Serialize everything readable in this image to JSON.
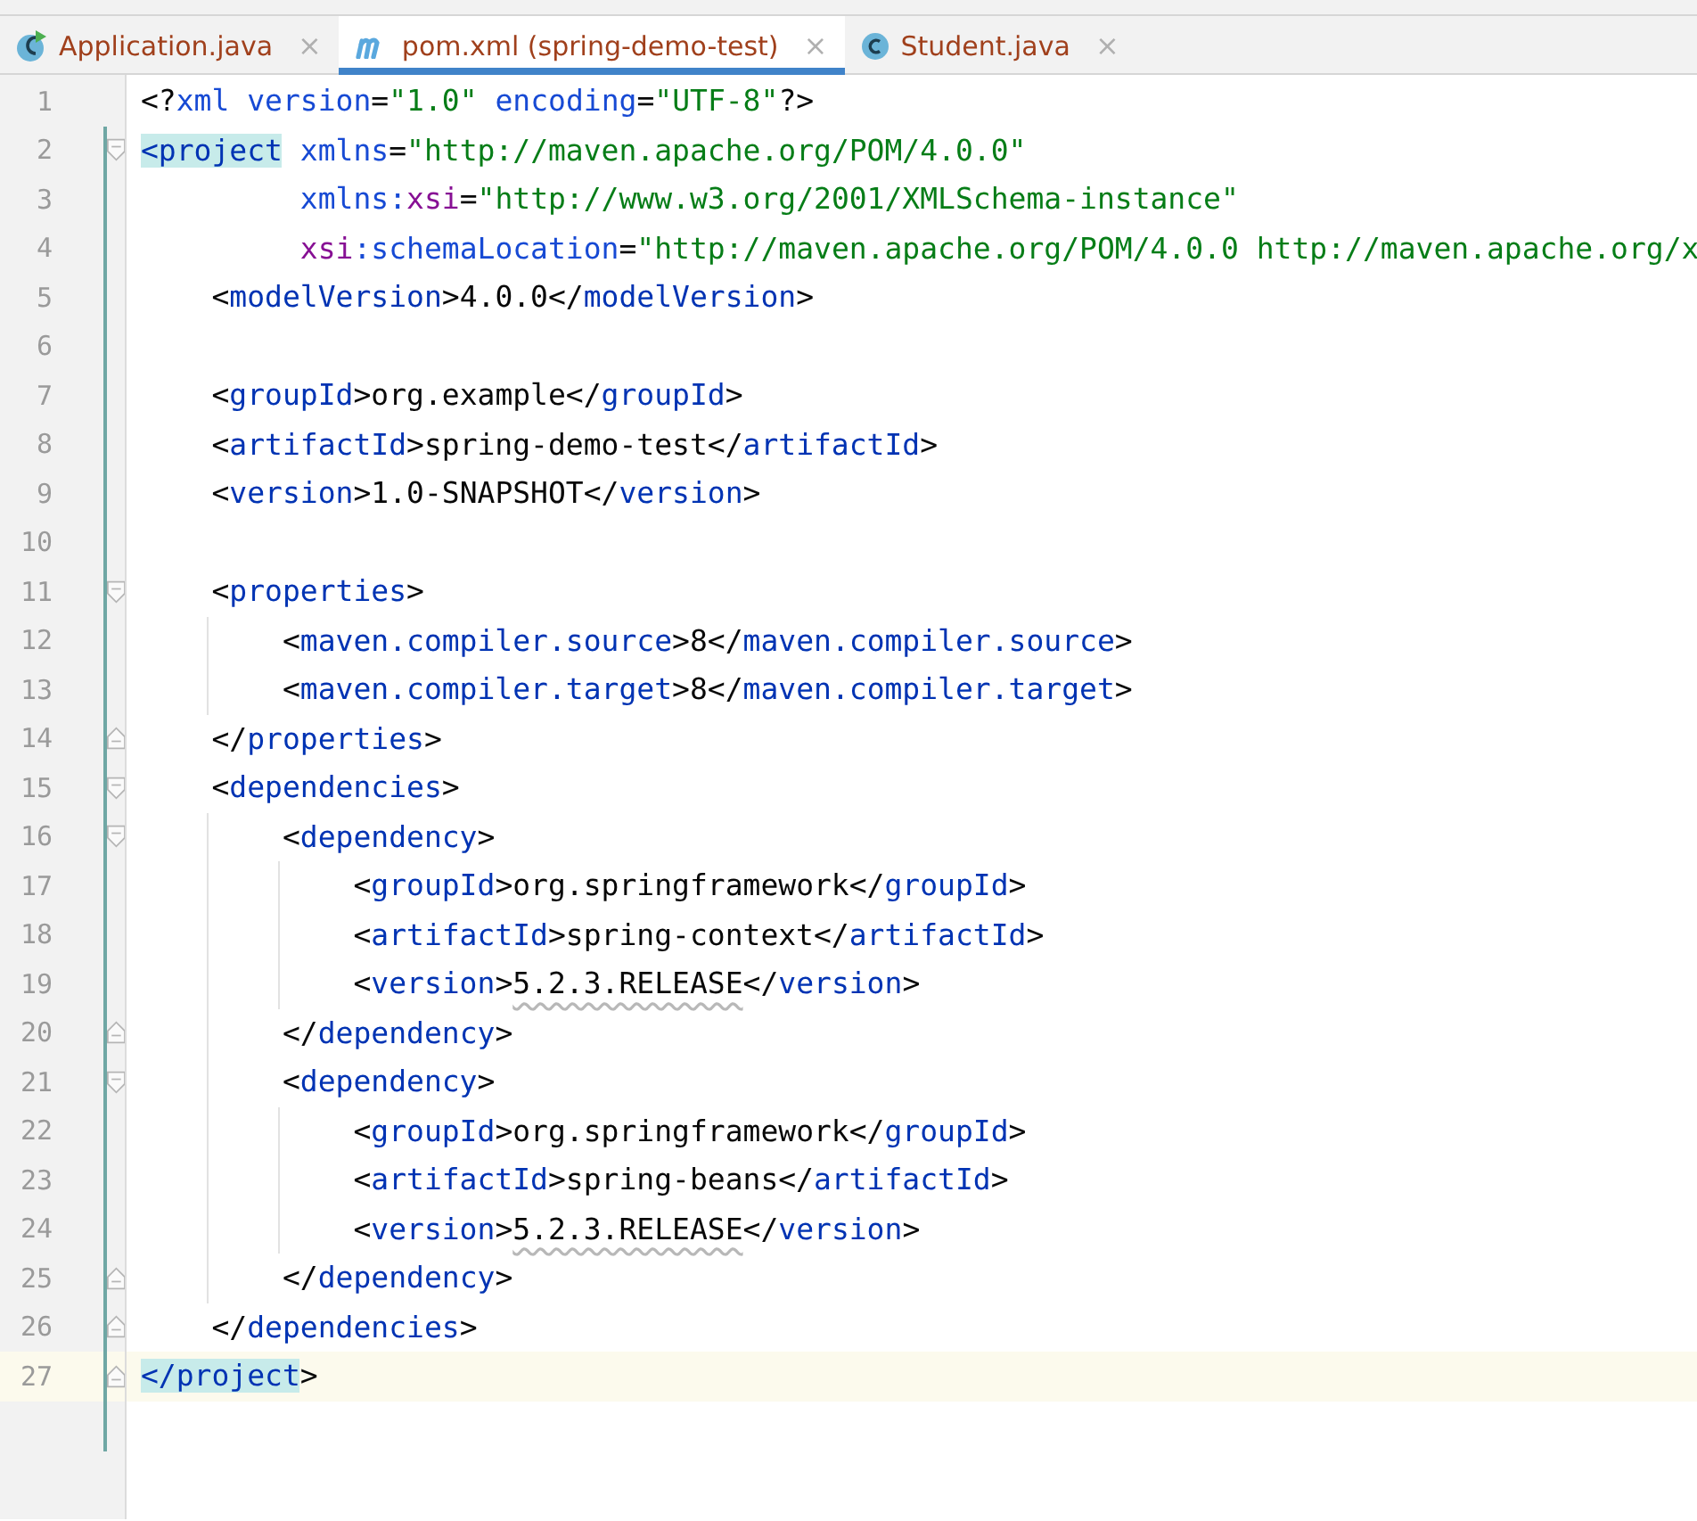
{
  "tabs": [
    {
      "label": "Application.java",
      "kind": "class_run",
      "selected": false,
      "close": "×"
    },
    {
      "label": "pom.xml (spring-demo-test)",
      "kind": "maven",
      "selected": true,
      "close": "×"
    },
    {
      "label": "Student.java",
      "kind": "class",
      "selected": false,
      "close": "×"
    }
  ],
  "editor": {
    "lines": [
      {
        "number": "1",
        "kind": "plain",
        "current": false,
        "tag_match": false,
        "tokens": [
          {
            "text": "<?",
            "kind": "bracket"
          },
          {
            "text": "xml ",
            "kind": "attr"
          },
          {
            "text": "version",
            "kind": "attr"
          },
          {
            "text": "=",
            "kind": "bracket"
          },
          {
            "text": "\"1.0\" ",
            "kind": "value"
          },
          {
            "text": "encoding",
            "kind": "attr"
          },
          {
            "text": "=",
            "kind": "bracket"
          },
          {
            "text": "\"UTF-8\"",
            "kind": "value"
          },
          {
            "text": "?>",
            "kind": "bracket"
          }
        ]
      },
      {
        "number": "2",
        "kind": "fold_start",
        "current": false,
        "tag_match": true,
        "tokens": [
          {
            "text": "<project",
            "kind": "tag"
          },
          {
            "text": " xmlns",
            "kind": "attr"
          },
          {
            "text": "=",
            "kind": "bracket"
          },
          {
            "text": "\"http://maven.apache.org/POM/4.0.0\"",
            "kind": "value"
          }
        ]
      },
      {
        "number": "3",
        "kind": "plain",
        "current": false,
        "tag_match": false,
        "tokens": [
          {
            "text": "         xmlns:",
            "kind": "attr"
          },
          {
            "text": "xsi",
            "kind": "ns"
          },
          {
            "text": "=",
            "kind": "bracket"
          },
          {
            "text": "\"http://www.w3.org/2001/XMLSchema-instance\"",
            "kind": "value"
          }
        ]
      },
      {
        "number": "4",
        "kind": "plain",
        "current": false,
        "tag_match": false,
        "tokens": [
          {
            "text": "         xsi",
            "kind": "ns"
          },
          {
            "text": ":schemaLocation",
            "kind": "attr"
          },
          {
            "text": "=",
            "kind": "bracket"
          },
          {
            "text": "\"http://maven.apache.org/POM/4.0.0 http://maven.apache.org/x",
            "kind": "value"
          }
        ]
      },
      {
        "number": "5",
        "kind": "plain",
        "current": false,
        "tag_match": false,
        "tokens": [
          {
            "text": "    <",
            "kind": "bracket"
          },
          {
            "text": "modelVersion",
            "kind": "tag"
          },
          {
            "text": ">4.0.0</",
            "kind": "bracket"
          },
          {
            "text": "modelVersion",
            "kind": "tag"
          },
          {
            "text": ">",
            "kind": "bracket"
          }
        ]
      },
      {
        "number": "6",
        "kind": "plain",
        "current": false,
        "tag_match": false
      },
      {
        "number": "7",
        "kind": "plain",
        "current": false,
        "tag_match": false,
        "tokens": [
          {
            "text": "    <",
            "kind": "bracket"
          },
          {
            "text": "groupId",
            "kind": "tag"
          },
          {
            "text": ">org.example</",
            "kind": "bracket"
          },
          {
            "text": "groupId",
            "kind": "tag"
          },
          {
            "text": ">",
            "kind": "bracket"
          }
        ]
      },
      {
        "number": "8",
        "kind": "plain",
        "current": false,
        "tag_match": false,
        "tokens": [
          {
            "text": "    <",
            "kind": "bracket"
          },
          {
            "text": "artifactId",
            "kind": "tag"
          },
          {
            "text": ">spring-demo-test</",
            "kind": "bracket"
          },
          {
            "text": "artifactId",
            "kind": "tag"
          },
          {
            "text": ">",
            "kind": "bracket"
          }
        ]
      },
      {
        "number": "9",
        "kind": "plain",
        "current": false,
        "tag_match": false,
        "tokens": [
          {
            "text": "    <",
            "kind": "bracket"
          },
          {
            "text": "version",
            "kind": "tag"
          },
          {
            "text": ">1.0-SNAPSHOT</",
            "kind": "bracket"
          },
          {
            "text": "version",
            "kind": "tag"
          },
          {
            "text": ">",
            "kind": "bracket"
          }
        ]
      },
      {
        "number": "10",
        "kind": "plain",
        "current": false,
        "tag_match": false
      },
      {
        "number": "11",
        "kind": "fold_start",
        "current": false,
        "tag_match": false,
        "tokens": [
          {
            "text": "    <",
            "kind": "bracket"
          },
          {
            "text": "properties",
            "kind": "tag"
          },
          {
            "text": ">",
            "kind": "bracket"
          }
        ]
      },
      {
        "number": "12",
        "kind": "plain",
        "current": false,
        "tag_match": false,
        "tokens": [
          {
            "text": "        <",
            "kind": "bracket"
          },
          {
            "text": "maven.compiler.source",
            "kind": "tag"
          },
          {
            "text": ">8</",
            "kind": "bracket"
          },
          {
            "text": "maven.compiler.source",
            "kind": "tag"
          },
          {
            "text": ">",
            "kind": "bracket"
          }
        ]
      },
      {
        "number": "13",
        "kind": "plain",
        "current": false,
        "tag_match": false,
        "tokens": [
          {
            "text": "        <",
            "kind": "bracket"
          },
          {
            "text": "maven.compiler.target",
            "kind": "tag"
          },
          {
            "text": ">8</",
            "kind": "bracket"
          },
          {
            "text": "maven.compiler.target",
            "kind": "tag"
          },
          {
            "text": ">",
            "kind": "bracket"
          }
        ]
      },
      {
        "number": "14",
        "kind": "fold_end",
        "current": false,
        "tag_match": false,
        "tokens": [
          {
            "text": "    </",
            "kind": "bracket"
          },
          {
            "text": "properties",
            "kind": "tag"
          },
          {
            "text": ">",
            "kind": "bracket"
          }
        ]
      },
      {
        "number": "15",
        "kind": "fold_start",
        "current": false,
        "tag_match": false,
        "tokens": [
          {
            "text": "    <",
            "kind": "bracket"
          },
          {
            "text": "dependencies",
            "kind": "tag"
          },
          {
            "text": ">",
            "kind": "bracket"
          }
        ]
      },
      {
        "number": "16",
        "kind": "fold_start",
        "current": false,
        "tag_match": false,
        "tokens": [
          {
            "text": "        <",
            "kind": "bracket"
          },
          {
            "text": "dependency",
            "kind": "tag"
          },
          {
            "text": ">",
            "kind": "bracket"
          }
        ]
      },
      {
        "number": "17",
        "kind": "plain",
        "current": false,
        "tag_match": false,
        "tokens": [
          {
            "text": "            <",
            "kind": "bracket"
          },
          {
            "text": "groupId",
            "kind": "tag"
          },
          {
            "text": ">org.springframework</",
            "kind": "bracket"
          },
          {
            "text": "groupId",
            "kind": "tag"
          },
          {
            "text": ">",
            "kind": "bracket"
          }
        ]
      },
      {
        "number": "18",
        "kind": "plain",
        "current": false,
        "tag_match": false,
        "tokens": [
          {
            "text": "            <",
            "kind": "bracket"
          },
          {
            "text": "artifactId",
            "kind": "tag"
          },
          {
            "text": ">spring-context</",
            "kind": "bracket"
          },
          {
            "text": "artifactId",
            "kind": "tag"
          },
          {
            "text": ">",
            "kind": "bracket"
          }
        ]
      },
      {
        "number": "19",
        "kind": "plain",
        "current": false,
        "tag_match": false,
        "tokens": [
          {
            "text": "            <",
            "kind": "bracket"
          },
          {
            "text": "version",
            "kind": "tag"
          },
          {
            "text": ">",
            "kind": "bracket"
          },
          {
            "text": "5.2.3.RELEASE",
            "kind": "warning"
          },
          {
            "text": "</",
            "kind": "bracket"
          },
          {
            "text": "version",
            "kind": "tag"
          },
          {
            "text": ">",
            "kind": "bracket"
          }
        ]
      },
      {
        "number": "20",
        "kind": "fold_end",
        "current": false,
        "tag_match": false,
        "tokens": [
          {
            "text": "        </",
            "kind": "bracket"
          },
          {
            "text": "dependency",
            "kind": "tag"
          },
          {
            "text": ">",
            "kind": "bracket"
          }
        ]
      },
      {
        "number": "21",
        "kind": "fold_start",
        "current": false,
        "tag_match": false,
        "tokens": [
          {
            "text": "        <",
            "kind": "bracket"
          },
          {
            "text": "dependency",
            "kind": "tag"
          },
          {
            "text": ">",
            "kind": "bracket"
          }
        ]
      },
      {
        "number": "22",
        "kind": "plain",
        "current": false,
        "tag_match": false,
        "tokens": [
          {
            "text": "            <",
            "kind": "bracket"
          },
          {
            "text": "groupId",
            "kind": "tag"
          },
          {
            "text": ">org.springframework</",
            "kind": "bracket"
          },
          {
            "text": "groupId",
            "kind": "tag"
          },
          {
            "text": ">",
            "kind": "bracket"
          }
        ]
      },
      {
        "number": "23",
        "kind": "plain",
        "current": false,
        "tag_match": false,
        "tokens": [
          {
            "text": "            <",
            "kind": "bracket"
          },
          {
            "text": "artifactId",
            "kind": "tag"
          },
          {
            "text": ">spring-beans</",
            "kind": "bracket"
          },
          {
            "text": "artifactId",
            "kind": "tag"
          },
          {
            "text": ">",
            "kind": "bracket"
          }
        ]
      },
      {
        "number": "24",
        "kind": "plain",
        "current": false,
        "tag_match": false,
        "tokens": [
          {
            "text": "            <",
            "kind": "bracket"
          },
          {
            "text": "version",
            "kind": "tag"
          },
          {
            "text": ">",
            "kind": "bracket"
          },
          {
            "text": "5.2.3.RELEASE",
            "kind": "warning"
          },
          {
            "text": "</",
            "kind": "bracket"
          },
          {
            "text": "version",
            "kind": "tag"
          },
          {
            "text": ">",
            "kind": "bracket"
          }
        ]
      },
      {
        "number": "25",
        "kind": "fold_end",
        "current": false,
        "tag_match": false,
        "tokens": [
          {
            "text": "        </",
            "kind": "bracket"
          },
          {
            "text": "dependency",
            "kind": "tag"
          },
          {
            "text": ">",
            "kind": "bracket"
          }
        ]
      },
      {
        "number": "26",
        "kind": "fold_end",
        "current": false,
        "tag_match": false,
        "tokens": [
          {
            "text": "    </",
            "kind": "bracket"
          },
          {
            "text": "dependencies",
            "kind": "tag"
          },
          {
            "text": ">",
            "kind": "bracket"
          }
        ]
      },
      {
        "number": "27",
        "kind": "fold_end",
        "current": true,
        "tag_match": true,
        "tokens": [
          {
            "text": "</project",
            "kind": "tag"
          },
          {
            "text": ">",
            "kind": "bracket"
          }
        ]
      }
    ]
  }
}
